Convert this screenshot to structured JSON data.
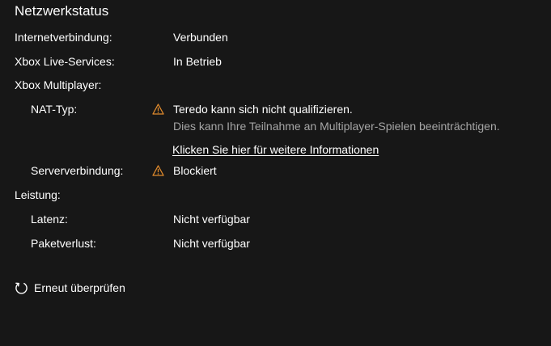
{
  "header": {
    "title": "Netzwerkstatus"
  },
  "rows": {
    "internet": {
      "label": "Internetverbindung:",
      "value": "Verbunden"
    },
    "xbox_live": {
      "label": "Xbox Live-Services:",
      "value": "In Betrieb"
    },
    "multiplayer": {
      "label": "Xbox Multiplayer:"
    },
    "nat": {
      "label": "NAT-Typ:",
      "value": "Teredo kann sich nicht qualifizieren.",
      "detail": "Dies kann Ihre Teilnahme an Multiplayer-Spielen beeinträchtigen.",
      "link": "Klicken Sie hier für weitere Informationen",
      "icon": "warning-icon"
    },
    "server": {
      "label": "Serververbindung:",
      "value": "Blockiert",
      "icon": "warning-icon"
    },
    "performance": {
      "label": "Leistung:"
    },
    "latency": {
      "label": "Latenz:",
      "value": "Nicht verfügbar"
    },
    "packet_loss": {
      "label": "Paketverlust:",
      "value": "Nicht verfügbar"
    }
  },
  "actions": {
    "retry_label": "Erneut überprüfen",
    "retry_icon": "refresh-icon"
  },
  "colors": {
    "background": "#171717",
    "text": "#ffffff",
    "secondary_text": "#a6a6a6",
    "warning": "#e08a2c"
  }
}
